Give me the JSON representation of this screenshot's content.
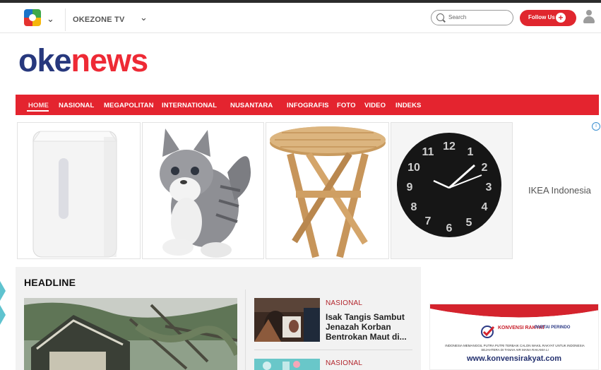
{
  "topbar": {
    "channel_label": "OKEZONE TV",
    "search_placeholder": "Search",
    "follow_label": "Follow Us"
  },
  "brand": {
    "part1": "oke",
    "part2": "news"
  },
  "nav": {
    "items": [
      "HOME",
      "NASIONAL",
      "MEGAPOLITAN",
      "INTERNATIONAL",
      "NUSANTARA",
      "INFOGRAFIS",
      "FOTO",
      "VIDEO",
      "INDEKS"
    ],
    "active": "HOME"
  },
  "ad_banner": {
    "advertiser": "IKEA Indonesia",
    "adchoices_symbol": "i"
  },
  "clock": {
    "numbers": [
      "12",
      "1",
      "2",
      "3",
      "4",
      "5",
      "6",
      "7",
      "8",
      "9",
      "10",
      "11"
    ]
  },
  "headline": {
    "title": "HEADLINE",
    "items": [
      {
        "category": "NASIONAL",
        "title": "Isak Tangis Sambut Jenazah Korban Bentrokan Maut di..."
      },
      {
        "category": "NASIONAL"
      }
    ]
  },
  "side_ad": {
    "brand_left": "KONVENSI RAKYAT",
    "brand_right": "PARTAI PERINDO",
    "small_text": "INDONESIA MEMANGGIL PUTRA PUTRI TERBAIK CALON WAKIL RAKYAT UNTUK INDONESIA SEJAHTERA DI TANAH AIR MANA RAKAMA LI",
    "url": "www.konvensirakyat.com"
  },
  "colors": {
    "accent_red": "#e4242f",
    "brand_blue": "#27387d",
    "brand_red": "#ee2a35"
  }
}
